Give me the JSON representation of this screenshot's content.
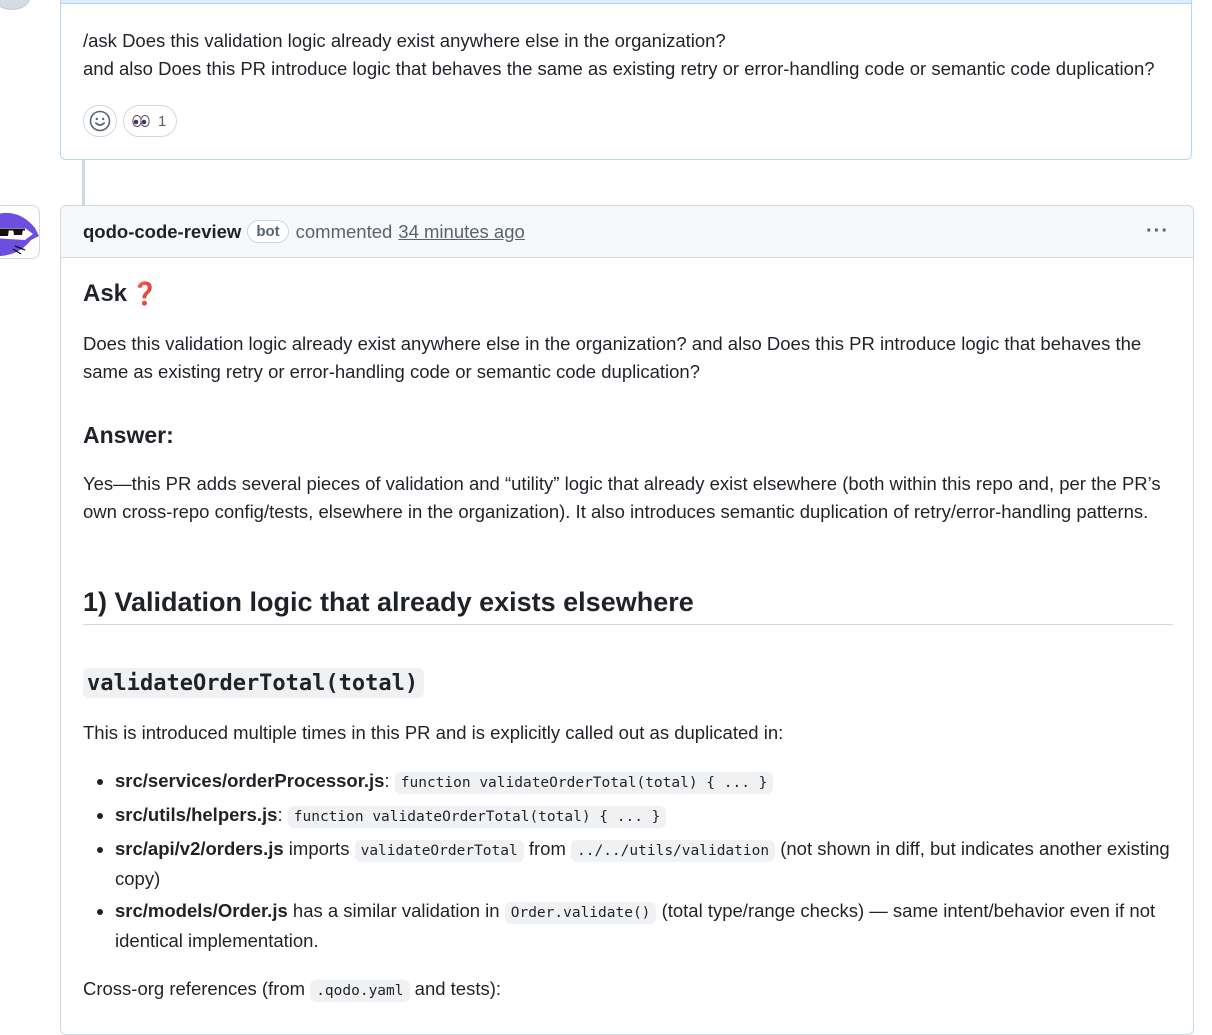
{
  "first_comment": {
    "line1": "/ask Does this validation logic already exist anywhere else in the organization?",
    "line2": "and also Does this PR introduce logic that behaves the same as existing retry or error-handling code or semantic code duplication?",
    "reaction_count": "1"
  },
  "comment": {
    "author": "qodo-code-review",
    "badge": "bot",
    "action": "commented",
    "time": "34 minutes ago",
    "menu_glyph": "···",
    "ask_heading": "Ask",
    "ask_icon": "❓",
    "question": "Does this validation logic already exist anywhere else in the organization? and also Does this PR introduce logic that behaves the same as existing retry or error-handling code or semantic code duplication?",
    "answer_heading": "Answer:",
    "answer": "Yes—this PR adds several pieces of validation and “utility” logic that already exist elsewhere (both within this repo and, per the PR’s own cross-repo config/tests, elsewhere in the organization). It also introduces semantic duplication of retry/error-handling patterns.",
    "section1_heading": "1) Validation logic that already exists elsewhere",
    "code_heading": "validateOrderTotal(total)",
    "intro": "This is introduced multiple times in this PR and is explicitly called out as duplicated in:",
    "bullets": [
      {
        "file": "src/services/orderProcessor.js",
        "sep": ":",
        "code": "function validateOrderTotal(total) { ... }"
      },
      {
        "file": "src/utils/helpers.js",
        "sep": ":",
        "code": "function validateOrderTotal(total) { ... }"
      },
      {
        "file": "src/api/v2/orders.js",
        "t1": "imports",
        "code1": "validateOrderTotal",
        "t2": "from",
        "code2": "../../utils/validation",
        "t3": "(not shown in diff, but indicates another existing copy)"
      },
      {
        "file": "src/models/Order.js",
        "t1": "has a similar validation in",
        "code1": "Order.validate()",
        "t2": "(total type/range checks) — same intent/behavior even if not identical implementation."
      }
    ],
    "crossorg_prefix": "Cross-org references (from",
    "crossorg_code": ".qodo.yaml",
    "crossorg_suffix": "and tests):"
  }
}
